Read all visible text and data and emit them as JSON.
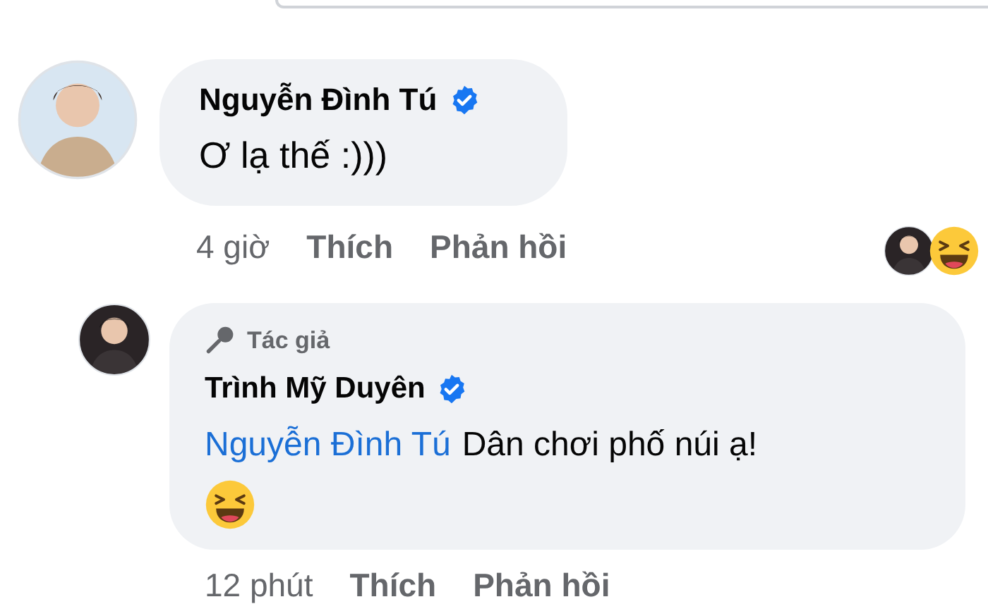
{
  "comment": {
    "author": "Nguyễn Đình Tú",
    "verified": true,
    "text": "Ơ lạ thế :)))",
    "time": "4 giờ",
    "actions": [
      "Thích",
      "Phản hồi"
    ]
  },
  "reply": {
    "badge": "Tác giả",
    "author": "Trình Mỹ Duyên",
    "verified": true,
    "mention": "Nguyễn Đình Tú",
    "text": "Dân chơi phố núi ạ!",
    "time": "12 phút",
    "actions": [
      "Thích",
      "Phản hồi"
    ]
  }
}
